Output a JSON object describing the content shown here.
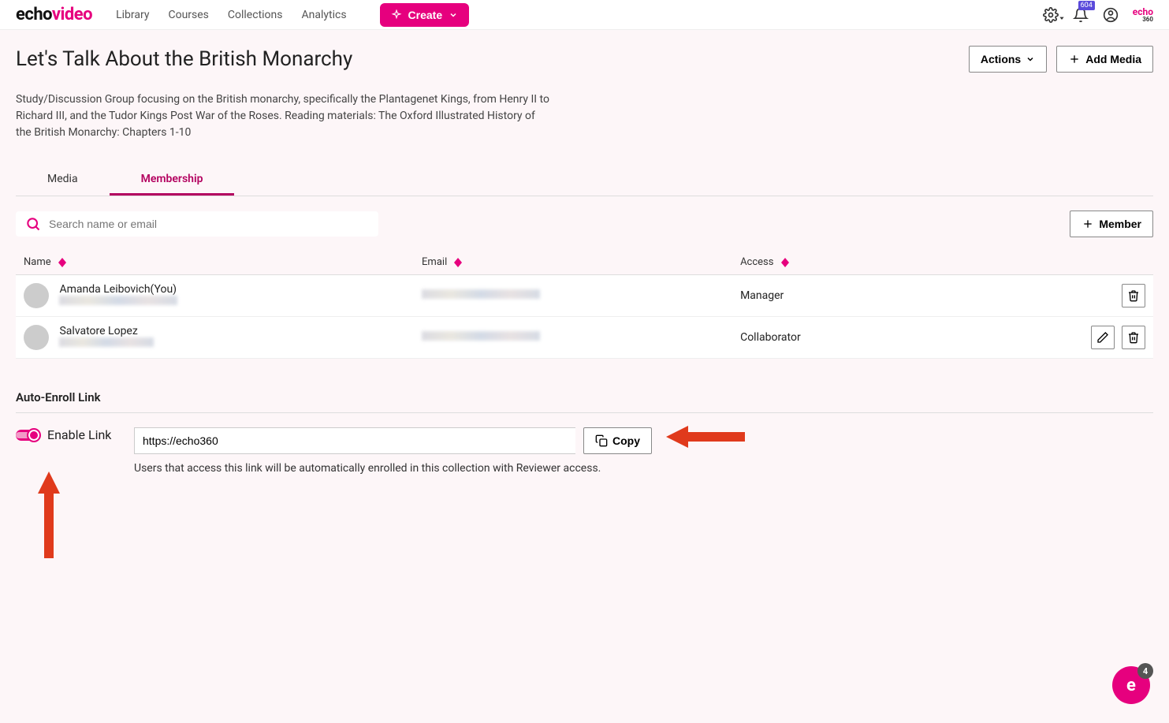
{
  "brand": {
    "part1": "echo",
    "part2": "video"
  },
  "nav": {
    "links": [
      "Library",
      "Courses",
      "Collections",
      "Analytics"
    ],
    "create_label": "Create",
    "notification_count": "604"
  },
  "page": {
    "title": "Let's Talk About the British Monarchy",
    "description": "Study/Discussion Group focusing on the British monarchy, specifically the Plantagenet Kings, from Henry II to Richard III, and the Tudor Kings Post War of the Roses. Reading materials: The Oxford Illustrated History of the British Monarchy: Chapters 1-10",
    "actions_label": "Actions",
    "add_media_label": "Add Media"
  },
  "tabs": {
    "media": "Media",
    "membership": "Membership"
  },
  "search": {
    "placeholder": "Search name or email"
  },
  "member_button_label": "Member",
  "table": {
    "headers": {
      "name": "Name",
      "email": "Email",
      "access": "Access"
    },
    "rows": [
      {
        "name": "Amanda Leibovich(You)",
        "access": "Manager",
        "editable": false
      },
      {
        "name": "Salvatore Lopez",
        "access": "Collaborator",
        "editable": true
      }
    ]
  },
  "auto_enroll": {
    "section_title": "Auto-Enroll Link",
    "toggle_label": "Enable Link",
    "toggle_on": true,
    "link_value": "https://echo360",
    "copy_label": "Copy",
    "help_text": "Users that access this link will be automatically enrolled in this collection with Reviewer access."
  },
  "fab_count": "4"
}
